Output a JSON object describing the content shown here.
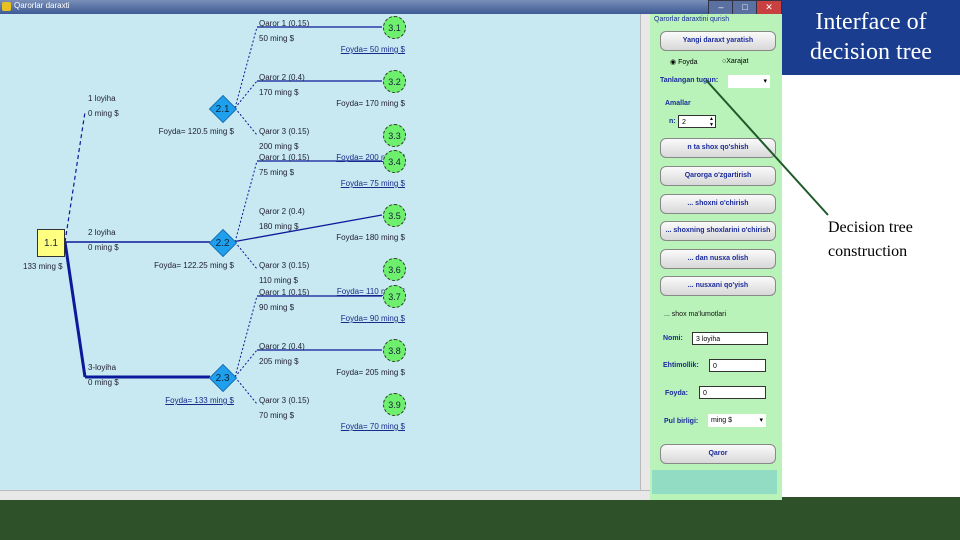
{
  "window": {
    "title": "Qarorlar daraxti"
  },
  "tree": {
    "root": {
      "id": "1.1",
      "value": "133 ming $"
    },
    "projects": [
      {
        "id": "2.1",
        "name": "1 loyiha",
        "cost": "0 ming $",
        "foyda": "Foyda= 120.5 ming $",
        "selected": false,
        "branches": [
          {
            "id": "3.1",
            "label": "Qaror 1 (0.15)",
            "value": "50 ming $",
            "foyda": "Foyda= 50 ming $"
          },
          {
            "id": "3.2",
            "label": "Qaror 2 (0.4)",
            "value": "170 ming $",
            "foyda": "Foyda= 170 ming $"
          },
          {
            "id": "3.3",
            "label": "Qaror 3 (0.15)",
            "value": "200 ming $",
            "foyda": "Foyda= 200 ming $"
          }
        ]
      },
      {
        "id": "2.2",
        "name": "2 loyiha",
        "cost": "0 ming $",
        "foyda": "Foyda= 122.25 ming $",
        "selected": false,
        "branches": [
          {
            "id": "3.4",
            "label": "Qaror 1 (0.15)",
            "value": "75 ming $",
            "foyda": "Foyda= 75 ming $"
          },
          {
            "id": "3.5",
            "label": "Qaror 2 (0.4)",
            "value": "180 ming $",
            "foyda": "Foyda= 180 ming $"
          },
          {
            "id": "3.6",
            "label": "Qaror 3 (0.15)",
            "value": "110 ming $",
            "foyda": "Foyda= 110 ming $"
          }
        ]
      },
      {
        "id": "2.3",
        "name": "3-loyiha",
        "cost": "0 ming $",
        "foyda": "Foyda= 133 ming $",
        "selected": true,
        "branches": [
          {
            "id": "3.7",
            "label": "Qaror 1 (0.15)",
            "value": "90 ming $",
            "foyda": "Foyda= 90 ming $"
          },
          {
            "id": "3.8",
            "label": "Qaror 2 (0.4)",
            "value": "205 ming $",
            "foyda": "Foyda= 205 ming $"
          },
          {
            "id": "3.9",
            "label": "Qaror 3 (0.15)",
            "value": "70 ming $",
            "foyda": "Foyda= 70 ming $"
          }
        ]
      }
    ]
  },
  "panel": {
    "group_title": "Qarorlar daraxtini qurish",
    "new_tree": "Yangi daraxt yaratish",
    "radio_foyda": "Foyda",
    "radio_xarajat": "Xarajat",
    "selected_node_label": "Tanlangan tugun:",
    "selected_node_value": "",
    "actions_title": "Amallar",
    "n_label": "n:",
    "n_value": "2",
    "buttons": [
      "n ta shox qo'shish",
      "Qarorga o'zgartirish",
      "... shoxni o'chirish",
      "... shoxning shoxlarini o'chirish",
      "... dan nusxa olish",
      "... nusxani qo'yish"
    ],
    "info_title": "... shox ma'lumotlari",
    "nomi_label": "Nomi:",
    "nomi_value": "3 loyiha",
    "ehtimollik_label": "Ehtimollik:",
    "ehtimollik_value": "0",
    "foyda_label": "Foyda:",
    "foyda_value": "0",
    "pul_label": "Pul birligi:",
    "pul_value": "ming $",
    "qaror": "Qaror"
  },
  "slide": {
    "title": "Interface of decision tree",
    "annotation": "Decision tree construction"
  },
  "colors": {
    "canvas": "#c8e9f1",
    "panel": "#b9f3b9",
    "diamond": "#1ea0ee",
    "leaf": "#6ef06e",
    "root": "#ffff80",
    "line": "#0a1a9a",
    "slide_title_bg": "#1b3d8f",
    "footer": "#2e5129"
  }
}
